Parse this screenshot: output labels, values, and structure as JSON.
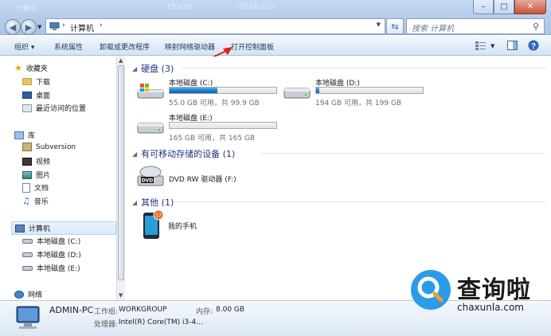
{
  "title_bar_ghost": [
    "计算机",
    "Chanel",
    "ChaXunLa"
  ],
  "window_controls": {
    "minimize": "–",
    "maximize": "□",
    "close": "✕"
  },
  "address_bar": {
    "breadcrumb": "计算机"
  },
  "search": {
    "placeholder": "搜索 计算机"
  },
  "toolbar": {
    "organize": "组织",
    "system_properties": "系统属性",
    "uninstall": "卸载或更改程序",
    "map_drive": "映射网络驱动器",
    "control_panel": "打开控制面板"
  },
  "sidebar": {
    "favorites": {
      "label": "收藏夹",
      "items": [
        {
          "label": "下载"
        },
        {
          "label": "桌面"
        },
        {
          "label": "最近访问的位置"
        }
      ]
    },
    "libraries": {
      "label": "库",
      "items": [
        {
          "label": "Subversion"
        },
        {
          "label": "视频"
        },
        {
          "label": "图片"
        },
        {
          "label": "文档"
        },
        {
          "label": "音乐"
        }
      ]
    },
    "computer": {
      "label": "计算机",
      "items": [
        {
          "label": "本地磁盘 (C:)"
        },
        {
          "label": "本地磁盘 (D:)"
        },
        {
          "label": "本地磁盘 (E:)"
        }
      ]
    },
    "network": {
      "label": "网络"
    }
  },
  "groups": {
    "hard_disks": {
      "title": "硬盘 (3)",
      "drives": [
        {
          "name": "本地磁盘 (C:)",
          "size_text": "55.0 GB 可用，共 99.9 GB",
          "used_fraction": 0.45
        },
        {
          "name": "本地磁盘 (D:)",
          "size_text": "194 GB 可用，共 199 GB",
          "used_fraction": 0.03
        },
        {
          "name": "本地磁盘 (E:)",
          "size_text": "165 GB 可用，共 165 GB",
          "used_fraction": 0.0
        }
      ]
    },
    "removable": {
      "title": "有可移动存储的设备 (1)",
      "device": {
        "name": "DVD RW 驱动器 (F:)",
        "icon_text": "DVD"
      }
    },
    "other": {
      "title": "其他 (1)",
      "device": {
        "name": "我的手机",
        "badge": "17"
      }
    }
  },
  "details_pane": {
    "computer_name": "ADMIN-PC",
    "workgroup_label": "工作组:",
    "workgroup": "WORKGROUP",
    "memory_label": "内存:",
    "memory": "8.00 GB",
    "processor_label": "处理器:",
    "processor": "Intel(R) Core(TM) i3-4..."
  },
  "watermark": {
    "title": "查询啦",
    "url": "chaxunla.com"
  },
  "colors": {
    "accent": "#2c9be8",
    "drive_bar": "#1a78c5",
    "arrow": "#e0201c",
    "group_title": "#1e3287"
  }
}
